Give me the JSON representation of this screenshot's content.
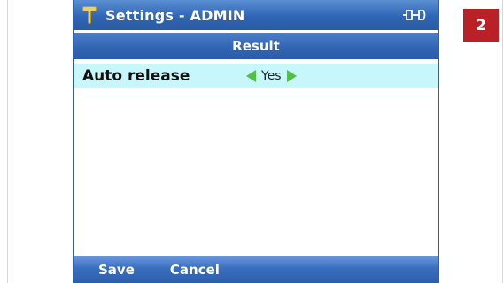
{
  "title_bar": {
    "title": "Settings - ADMIN",
    "left_icon": "wrench-icon",
    "right_icon": "plug-icon"
  },
  "section": {
    "title": "Result"
  },
  "settings": {
    "items": [
      {
        "label": "Auto release",
        "value": "Yes"
      }
    ]
  },
  "soft_keys": {
    "save_label": "Save",
    "cancel_label": "Cancel"
  },
  "step_badge": "2",
  "colors": {
    "title_bar": "#2f66b5",
    "selected_row": "#c8f7fb",
    "arrow": "#4fbf46",
    "badge": "#b92126"
  }
}
